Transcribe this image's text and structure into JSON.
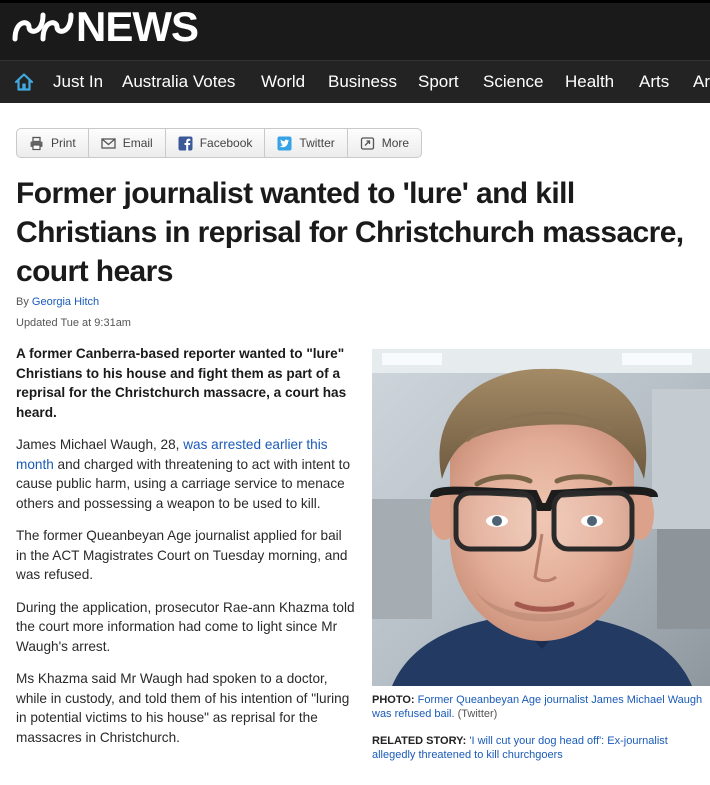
{
  "masthead": {
    "logo_text": "NEWS",
    "nav_items": [
      "Just In",
      "Australia Votes",
      "World",
      "Business",
      "Sport",
      "Science",
      "Health",
      "Arts",
      "Ar"
    ]
  },
  "share": {
    "print": "Print",
    "email": "Email",
    "facebook": "Facebook",
    "twitter": "Twitter",
    "more": "More"
  },
  "article": {
    "headline": "Former journalist wanted to 'lure' and kill Christians in reprisal for Christchurch massacre, court hears",
    "byline_prefix": "By ",
    "author": "Georgia Hitch",
    "updated": "Updated Tue at 9:31am",
    "lede": "A former Canberra-based reporter wanted to \"lure\" Christians to his house and fight them as part of a reprisal for the Christchurch massacre, a court has heard.",
    "p1_before": "James Michael Waugh, 28, ",
    "p1_link": "was arrested earlier this month",
    "p1_after": " and charged with threatening to act with intent to cause public harm, using a carriage service to menace others and possessing a weapon to be used to kill.",
    "p2": "The former Queanbeyan Age journalist applied for bail in the ACT Magistrates Court on Tuesday morning, and was refused.",
    "p3": "During the application, prosecutor Rae-ann Khazma told the court more information had come to light since Mr Waugh's arrest.",
    "p4": "Ms Khazma said Mr Waugh had spoken to a doctor, while in custody, and told them of his intention of \"luring in potential victims to his house\" as reprisal for the massacres in Christchurch."
  },
  "photo": {
    "label": "PHOTO:",
    "caption": "Former Queanbeyan Age journalist James Michael Waugh was refused bail.",
    "credit": "(Twitter)"
  },
  "related": {
    "label": "RELATED STORY:",
    "link": "'I will cut your dog head off': Ex-journalist allegedly threatened to kill churchgoers"
  },
  "colors": {
    "masthead_bg": "#1a1a1a",
    "link": "#1a5bb8",
    "home_icon": "#3fa9e0"
  }
}
